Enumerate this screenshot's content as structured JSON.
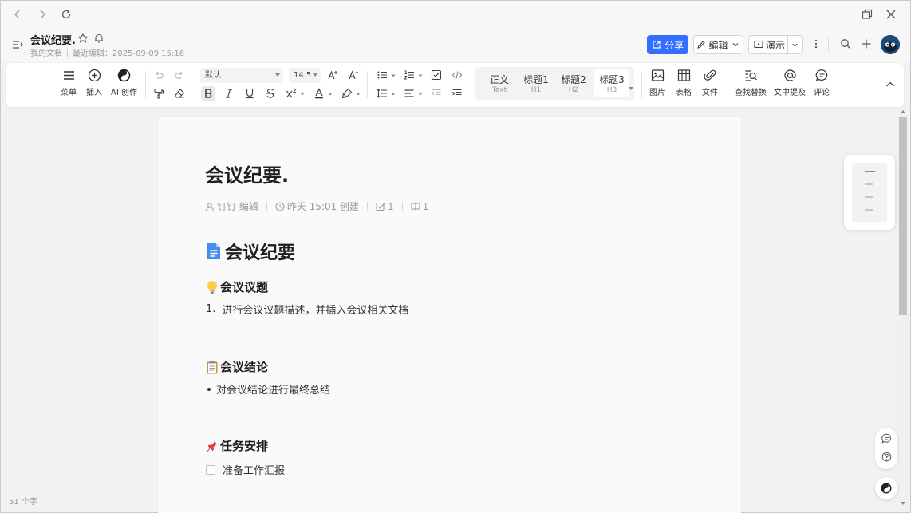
{
  "doc": {
    "title": "会议纪要.",
    "location": "我的文档",
    "last_edit": "最近编辑：2025-09-09 15:16"
  },
  "header": {
    "share_label": "分享",
    "edit_label": "编辑",
    "present_label": "演示"
  },
  "toolbar": {
    "menu_label": "菜单",
    "insert_label": "插入",
    "ai_label": "AI 创作",
    "font_family": "默认",
    "font_size": "14.5",
    "styles": [
      {
        "main": "正文",
        "sub": "Text"
      },
      {
        "main": "标题1",
        "sub": "H1"
      },
      {
        "main": "标题2",
        "sub": "H2"
      },
      {
        "main": "标题3",
        "sub": "H3"
      }
    ],
    "image_label": "图片",
    "table_label": "表格",
    "file_label": "文件",
    "find_replace_label": "查找替换",
    "mention_label": "文中提及",
    "comment_label": "评论"
  },
  "page": {
    "title": "会议纪要.",
    "meta": {
      "author": "钉钉 编辑",
      "created": "昨天 15:01 创建",
      "tasks": "1",
      "reads": "1"
    },
    "h1": "会议纪要",
    "sections": [
      {
        "heading": "会议议题",
        "emoji": "bulb",
        "line": "进行会议议题描述，并插入会议相关文档",
        "marker": "1."
      },
      {
        "heading": "会议结论",
        "emoji": "clipboard",
        "line": "对会议结论进行最终总结"
      },
      {
        "heading": "任务安排",
        "emoji": "pushpin",
        "line": "准备工作汇报"
      }
    ]
  },
  "status": {
    "word_count": "51 个字"
  },
  "colors": {
    "accent": "#3370ff",
    "page_bg": "#fafafa",
    "app_bg": "#f2f2f3"
  }
}
